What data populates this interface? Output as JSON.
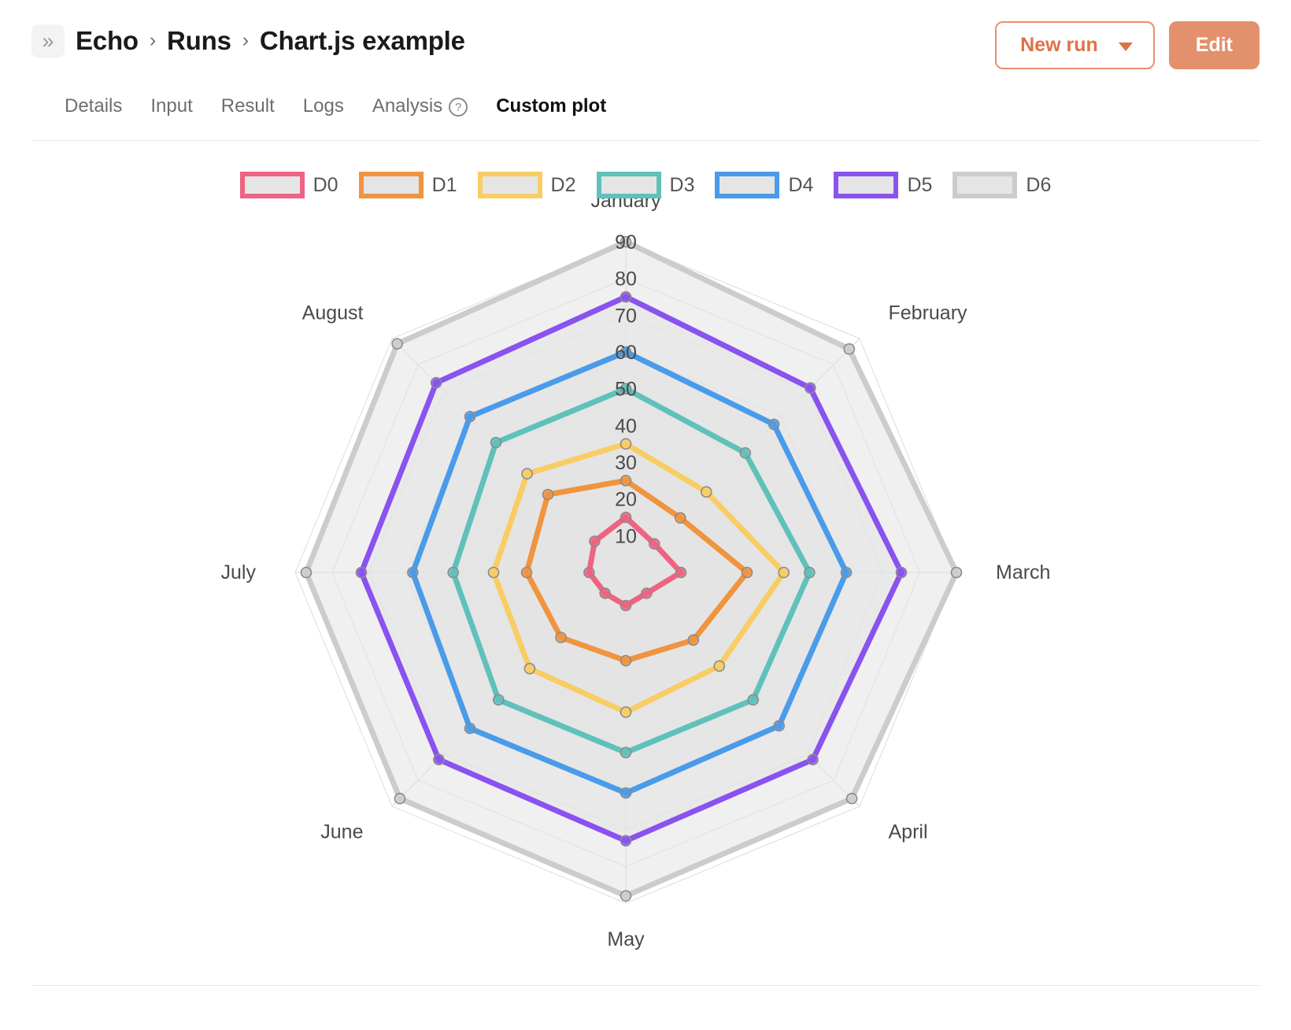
{
  "header": {
    "collapse_icon": "double-chevron-right",
    "breadcrumb": [
      "Echo",
      "Runs",
      "Chart.js example"
    ],
    "separator": "›",
    "tabs": [
      {
        "label": "Details",
        "active": false
      },
      {
        "label": "Input",
        "active": false
      },
      {
        "label": "Result",
        "active": false
      },
      {
        "label": "Logs",
        "active": false
      },
      {
        "label": "Analysis",
        "active": false,
        "help": "?"
      },
      {
        "label": "Custom plot",
        "active": true
      }
    ],
    "new_run_label": "New run",
    "new_run_caret": "chevron-down",
    "edit_label": "Edit",
    "accent_outline": "#e79070",
    "accent_text": "#de7246",
    "accent_fill": "#e3906c"
  },
  "chart_data": {
    "type": "radar",
    "title": "",
    "categories": [
      "January",
      "February",
      "March",
      "April",
      "May",
      "June",
      "July",
      "August"
    ],
    "tick_labels": [
      "10",
      "20",
      "30",
      "40",
      "50",
      "60",
      "70",
      "80",
      "90"
    ],
    "ticks": [
      10,
      20,
      30,
      40,
      50,
      60,
      70,
      80,
      90
    ],
    "rlim": [
      0,
      90
    ],
    "grid": true,
    "legend_position": "top",
    "series": [
      {
        "name": "D0",
        "color": "#ef6382",
        "values": [
          15,
          11,
          15,
          8,
          9,
          8,
          10,
          12
        ]
      },
      {
        "name": "D1",
        "color": "#f0943f",
        "values": [
          25,
          21,
          33,
          26,
          24,
          25,
          27,
          30
        ]
      },
      {
        "name": "D2",
        "color": "#f8cd63",
        "values": [
          35,
          31,
          43,
          36,
          38,
          37,
          36,
          38
        ]
      },
      {
        "name": "D3",
        "color": "#5fc1ba",
        "values": [
          50,
          46,
          50,
          49,
          49,
          49,
          47,
          50
        ]
      },
      {
        "name": "D4",
        "color": "#4a9bea",
        "values": [
          60,
          57,
          60,
          59,
          60,
          60,
          58,
          60
        ]
      },
      {
        "name": "D5",
        "color": "#8a52ef",
        "values": [
          75,
          71,
          75,
          72,
          73,
          72,
          72,
          73
        ]
      },
      {
        "name": "D6",
        "color": "#cccccc",
        "values": [
          90,
          86,
          90,
          87,
          88,
          87,
          87,
          88
        ]
      }
    ]
  }
}
